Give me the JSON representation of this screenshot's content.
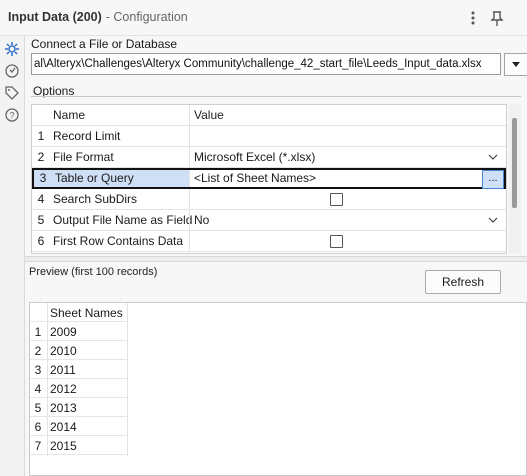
{
  "window": {
    "tool_name": "Input Data (200)",
    "subtitle": "- Configuration",
    "menu_icon": "more-vert-icon",
    "pin_icon": "pin-icon"
  },
  "left_icons": [
    "gear-icon",
    "tool-help-icon",
    "tag-icon",
    "help-icon"
  ],
  "connect": {
    "label": "Connect a File or Database",
    "path": "al\\Alteryx\\Challenges\\Alteryx Community\\challenge_42_start_file\\Leeds_Input_data.xlsx"
  },
  "options": {
    "label": "Options",
    "header": {
      "name": "Name",
      "value": "Value"
    },
    "rows": [
      {
        "num": "1",
        "name": "Record Limit",
        "value": ""
      },
      {
        "num": "2",
        "name": "File Format",
        "value": "Microsoft Excel (*.xlsx)"
      },
      {
        "num": "3",
        "name": "Table or Query",
        "value": "<List of Sheet Names>",
        "button": "..."
      },
      {
        "num": "4",
        "name": "Search SubDirs",
        "value": ""
      },
      {
        "num": "5",
        "name": "Output File Name as Field",
        "value": "No"
      },
      {
        "num": "6",
        "name": "First Row Contains Data",
        "value": ""
      }
    ]
  },
  "preview": {
    "label": "Preview (first 100 records)",
    "refresh_label": "Refresh",
    "column": "Sheet Names",
    "rows": [
      {
        "num": "1",
        "value": "2009"
      },
      {
        "num": "2",
        "value": "2010"
      },
      {
        "num": "3",
        "value": "2011"
      },
      {
        "num": "4",
        "value": "2012"
      },
      {
        "num": "5",
        "value": "2013"
      },
      {
        "num": "6",
        "value": "2014"
      },
      {
        "num": "7",
        "value": "2015"
      }
    ]
  },
  "colors": {
    "selected_row": "#cfe0f6",
    "accent": "#2b6cc4"
  }
}
